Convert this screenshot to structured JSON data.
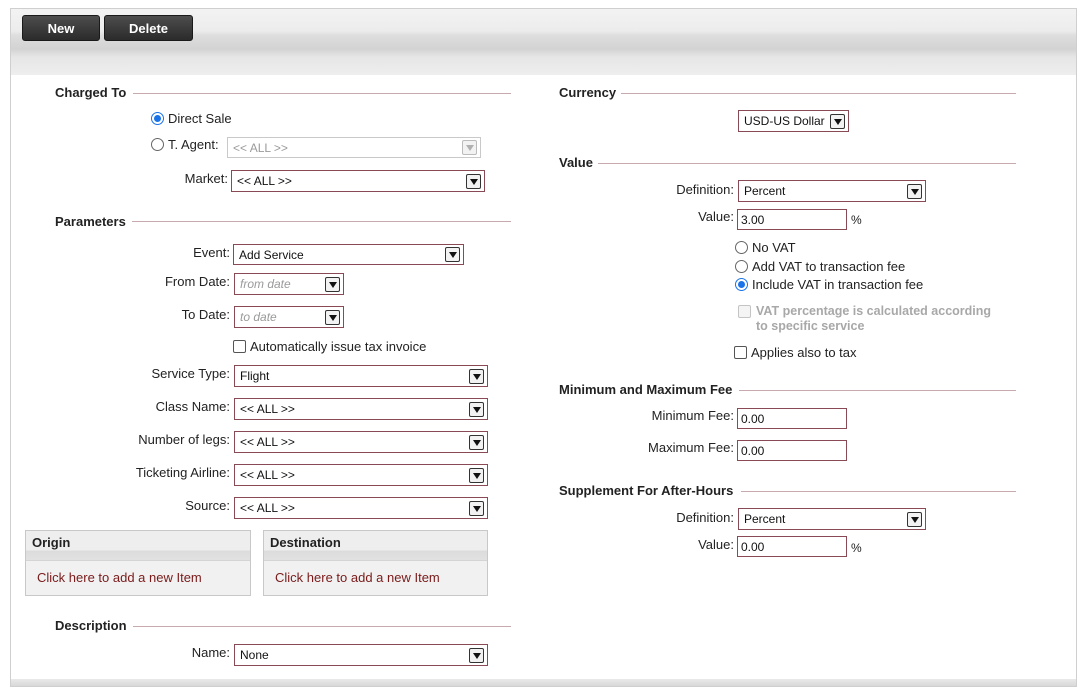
{
  "toolbar": {
    "new_label": "New",
    "delete_label": "Delete"
  },
  "charged_to": {
    "title": "Charged To",
    "direct_sale_label": "Direct Sale",
    "direct_sale_checked": true,
    "t_agent_label": "T. Agent:",
    "t_agent_value": "<< ALL >>",
    "market_label": "Market:",
    "market_value": "<< ALL >>"
  },
  "parameters": {
    "title": "Parameters",
    "event_label": "Event:",
    "event_value": "Add Service",
    "from_date_label": "From Date:",
    "from_date_placeholder": "from date",
    "to_date_label": "To Date:",
    "to_date_placeholder": "to date",
    "auto_invoice_label": "Automatically issue tax invoice",
    "service_type_label": "Service Type:",
    "service_type_value": "Flight",
    "class_name_label": "Class Name:",
    "class_name_value": "<< ALL >>",
    "legs_label": "Number of legs:",
    "legs_value": "<< ALL >>",
    "airline_label": "Ticketing Airline:",
    "airline_value": "<< ALL >>",
    "source_label": "Source:",
    "source_value": "<< ALL >>"
  },
  "origin": {
    "title": "Origin",
    "link": "Click here to add a new Item"
  },
  "destination": {
    "title": "Destination",
    "link": "Click here to add a new Item"
  },
  "description": {
    "title": "Description",
    "name_label": "Name:",
    "name_value": "None"
  },
  "currency": {
    "title": "Currency",
    "value": "USD-US Dollar"
  },
  "value_section": {
    "title": "Value",
    "definition_label": "Definition:",
    "definition_value": "Percent",
    "value_label": "Value:",
    "value": "3.00",
    "unit": "%",
    "no_vat_label": "No VAT",
    "add_vat_label": "Add VAT to transaction fee",
    "include_vat_label": "Include VAT in transaction fee",
    "selected_vat_option": "Include VAT in transaction fee",
    "vat_pct_label": "VAT percentage is calculated according to specific service",
    "applies_tax_label": "Applies also to tax"
  },
  "min_max": {
    "title": "Minimum and Maximum Fee",
    "min_label": "Minimum Fee:",
    "min_value": "0.00",
    "max_label": "Maximum Fee:",
    "max_value": "0.00"
  },
  "supplement": {
    "title": "Supplement For After-Hours",
    "definition_label": "Definition:",
    "definition_value": "Percent",
    "value_label": "Value:",
    "value": "0.00",
    "unit": "%"
  },
  "colors": {
    "accent": "#1a73e8",
    "border": "#8a4a55",
    "link": "#7a1a1a",
    "button": "#333333"
  }
}
